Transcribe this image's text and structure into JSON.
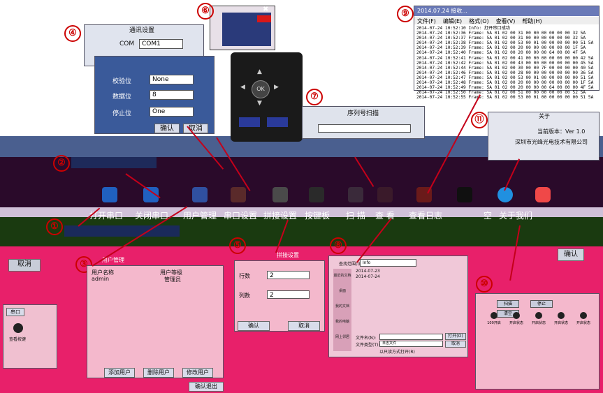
{
  "callouts": {
    "n1": "①",
    "n2": "②",
    "n3": "③",
    "n4": "④",
    "n5": "⑤",
    "n6": "⑥",
    "n7": "⑦",
    "n8": "⑧",
    "n9": "⑨",
    "n10": "⑩",
    "n11": "⑪"
  },
  "toolbar": {
    "open_port": "打开串口",
    "close_port": "关闭串口",
    "user_mgmt": "用户管理",
    "port_settings": "串口设置",
    "splice_settings": "拼接设置",
    "keypad": "按键板",
    "scan": "扫 描",
    "view": "查 看",
    "view_log": "查看日志",
    "empty": "空",
    "about": "关于我们"
  },
  "comm_dialog": {
    "title": "通讯设置",
    "com_label": "COM",
    "com_value": "COM1",
    "parity_label": "校验位",
    "parity_value": "None",
    "databits_label": "数据位",
    "databits_value": "8",
    "stopbits_label": "停止位",
    "stopbits_value": "One",
    "ok": "确认",
    "cancel": "取消"
  },
  "remote": {
    "ok": "OK"
  },
  "serial_scan": {
    "title": "序列号扫描"
  },
  "log_window": {
    "title": "2014.07.24 接收...",
    "menu": [
      "文件(F)",
      "编辑(E)",
      "格式(O)",
      "查看(V)",
      "帮助(H)"
    ],
    "lines": [
      "2014-07-24 10:52:10 Info: 打开串口成功",
      "2014-07-24 10:52:36 Frame: 5A 01 02 00 31 00 00 00 00 00 00 32 5A",
      "2014-07-24 10:52:37 Frame: 5A 01 02 00 31 00 00 00 00 00 00 32 5A",
      "2014-07-24 10:52:38 Frame: 5A 01 02 00 53 00 01 00 00 00 00 00 51 5A",
      "2014-07-24 10:52:39 Frame: 5A 01 02 00 20 00 00 00 00 00 00 1F 5A",
      "2014-07-24 10:52:40 Frame: 5A 01 02 00 20 00 00 00 64 00 00 4F 5A",
      "2014-07-24 10:52:41 Frame: 5A 01 02 00 41 00 00 00 00 00 00 00 42 5A",
      "2014-07-24 10:52:42 Frame: 5A 01 02 00 43 00 00 00 00 00 00 00 45 5A",
      "2014-07-24 10:52:44 Frame: 5A 01 02 00 30 00 00 7F 00 00 00 00 40 5A",
      "2014-07-24 10:52:46 Frame: 5A 01 02 00 28 00 00 00 00 00 00 00 36 5A",
      "2014-07-24 10:52:47 Frame: 5A 01 02 00 53 00 01 00 00 00 00 00 51 5A",
      "2014-07-24 10:52:48 Frame: 5A 01 02 00 20 00 00 00 00 00 00 00 1F 5A",
      "2014-07-24 10:52:49 Frame: 5A 01 02 00 20 00 00 00 64 00 00 00 4F 5A",
      "2014-07-24 10:52:50 Frame: 5A 01 02 00 51 00 00 00 00 00 00 52 5A",
      "2014-07-24 10:52:55 Frame: 5A 01 02 00 53 00 01 00 00 00 00 00 51 5A"
    ]
  },
  "about": {
    "title": "关于",
    "version": "当前版本：Ver 1.0",
    "company": "深圳市光峰光电技术有限公司"
  },
  "user_panel": {
    "tab": "用户管理",
    "col_name": "用户名称",
    "col_level": "用户等级",
    "row_name": "admin",
    "row_level": "管理员",
    "add": "添加用户",
    "delete": "删除用户",
    "modify": "修改用户",
    "exit": "确认退出"
  },
  "splice": {
    "title": "拼接设置",
    "rows_label": "行数",
    "rows_value": "2",
    "cols_label": "列数",
    "cols_value": "2",
    "ok": "确认",
    "cancel": "取消"
  },
  "file_dialog": {
    "lookin": "查找范围(I):",
    "folder": "Info",
    "file1": "2014-07-23",
    "file2": "2014-07-24",
    "filename_label": "文件名(N):",
    "filetype_label": "文件类型(T):",
    "filetype_value": "日志文件",
    "readonly": "以只读方式打开(R)",
    "open": "打开(O)",
    "cancel": "取消",
    "places": [
      "最近的文档",
      "桌面",
      "我的文档",
      "我的电脑",
      "网上邻居"
    ]
  },
  "left_misc": {
    "cancel": "取消",
    "port": "串口",
    "label": "查看按键"
  },
  "confirm_right": {
    "ok": "确认"
  },
  "scan_panel": {
    "labels": [
      "扫描",
      "停止",
      "清空"
    ],
    "items": [
      "100开启",
      "开启状态",
      "开启状态",
      "开启状态",
      "开启状态"
    ]
  }
}
